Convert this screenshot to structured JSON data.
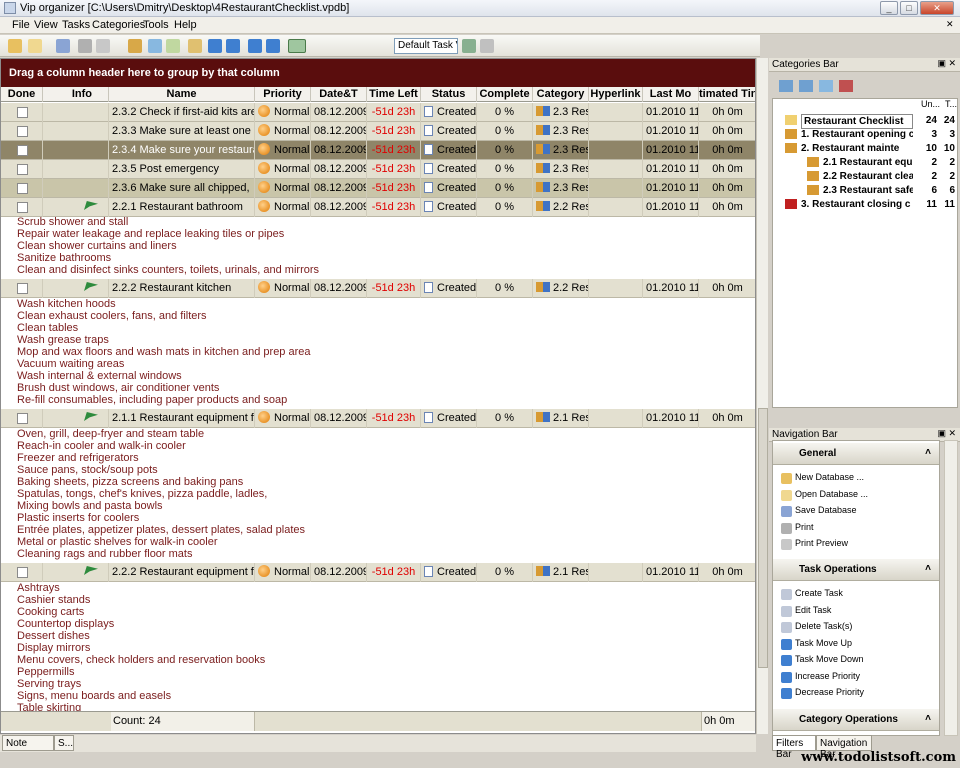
{
  "window": {
    "title": "Vip organizer [C:\\Users\\Dmitry\\Desktop\\4RestaurantChecklist.vpdb]"
  },
  "menu": [
    "File",
    "View",
    "Tasks",
    "Categories",
    "Tools",
    "Help"
  ],
  "toolbar": {
    "task_view": "Default Task V"
  },
  "grid": {
    "group_hint": "Drag a column header here to group by that column",
    "columns": [
      "Done",
      "Info",
      "Name",
      "Priority",
      "Date&T",
      "Time Left",
      "Status",
      "Complete",
      "Category",
      "Hyperlink",
      "Last Mo",
      "timated Tin"
    ],
    "rows": [
      {
        "name": "2.3.2 Check if first-aid kits are",
        "priority": "Normal",
        "date": "08.12.2009",
        "left": "-51d 23h",
        "status": "Created",
        "complete": "0 %",
        "category": "2.3 Rest",
        "lastmod": "01.2010 11:",
        "est": "0h 0m"
      },
      {
        "name": "2.3.3 Make sure at least one",
        "priority": "Normal",
        "date": "08.12.2009",
        "left": "-51d 23h",
        "status": "Created",
        "complete": "0 %",
        "category": "2.3 Rest",
        "lastmod": "01.2010 11:",
        "est": "0h 0m"
      },
      {
        "name": "2.3.4 Make sure your restaurant",
        "priority": "Normal",
        "date": "08.12.2009",
        "left": "-51d 23h",
        "status": "Created",
        "complete": "0 %",
        "category": "2.3 Rest",
        "lastmod": "01.2010 11:",
        "est": "0h 0m"
      },
      {
        "name": "2.3.5 Post emergency",
        "priority": "Normal",
        "date": "08.12.2009",
        "left": "-51d 23h",
        "status": "Created",
        "complete": "0 %",
        "category": "2.3 Rest",
        "lastmod": "01.2010 11:",
        "est": "0h 0m"
      },
      {
        "name": "2.3.6 Make sure all chipped,",
        "priority": "Normal",
        "date": "08.12.2009",
        "left": "-51d 23h",
        "status": "Created",
        "complete": "0 %",
        "category": "2.3 Rest",
        "lastmod": "01.2010 11:",
        "est": "0h 0m"
      },
      {
        "name": "2.2.1 Restaurant bathroom",
        "priority": "Normal",
        "date": "08.12.2009",
        "left": "-51d 23h",
        "status": "Created",
        "complete": "0 %",
        "category": "2.2 Rest",
        "lastmod": "01.2010 11:",
        "est": "0h 0m"
      },
      {
        "name": "2.2.2 Restaurant kitchen",
        "priority": "Normal",
        "date": "08.12.2009",
        "left": "-51d 23h",
        "status": "Created",
        "complete": "0 %",
        "category": "2.2 Rest",
        "lastmod": "01.2010 11:",
        "est": "0h 0m"
      },
      {
        "name": "2.1.1 Restaurant equipment for",
        "priority": "Normal",
        "date": "08.12.2009",
        "left": "-51d 23h",
        "status": "Created",
        "complete": "0 %",
        "category": "2.1 Rest",
        "lastmod": "01.2010 11:",
        "est": "0h 0m"
      },
      {
        "name": "2.2.2 Restaurant equipment for",
        "priority": "Normal",
        "date": "08.12.2009",
        "left": "-51d 23h",
        "status": "Created",
        "complete": "0 %",
        "category": "2.1 Rest",
        "lastmod": "01.2010 11:",
        "est": "0h 0m"
      }
    ],
    "notes": [
      [
        "Scrub shower and stall",
        "Repair water leakage and replace leaking tiles or pipes",
        "Clean shower curtains and liners",
        "Sanitize bathrooms",
        "Clean and disinfect sinks counters, toilets, urinals, and mirrors"
      ],
      [
        "Wash kitchen hoods",
        "Clean exhaust coolers, fans, and filters",
        "Clean tables",
        "Wash grease traps",
        "Mop and wax floors and wash mats in kitchen and prep area",
        "Vacuum waiting areas",
        "Wash internal & external windows",
        "Brush dust windows, air conditioner vents",
        "Re-fill consumables, including paper products and soap"
      ],
      [
        "Oven, grill, deep-fryer and steam table",
        "Reach-in cooler and walk-in cooler",
        "Freezer and refrigerators",
        "Sauce pans, stock/soup pots",
        "Baking sheets, pizza screens and baking pans",
        "Spatulas, tongs, chef's knives, pizza paddle, ladles,",
        "Mixing bowls and pasta bowls",
        "Plastic inserts for coolers",
        "Entrée plates, appetizer plates, dessert plates, salad plates",
        "Metal or plastic shelves for walk-in cooler",
        "Cleaning rags and rubber floor mats"
      ],
      [
        "Ashtrays",
        "Cashier stands",
        "Cooking carts",
        "Countertop displays",
        "Dessert dishes",
        "Display mirrors",
        "Menu covers, check holders and reservation books",
        "Peppermills",
        "Serving trays",
        "Signs, menu boards and easels",
        "Table skirting"
      ]
    ],
    "footer": {
      "count": "Count: 24",
      "est": "0h 0m"
    }
  },
  "note_tabs": [
    "Note",
    "S..."
  ],
  "categories": {
    "title": "Categories Bar",
    "col_un": "Un...",
    "col_t": "T...",
    "items": [
      {
        "label": "Restaurant Checklist",
        "a": "24",
        "b": "24"
      },
      {
        "label": "1. Restaurant opening c",
        "a": "3",
        "b": "3"
      },
      {
        "label": "2. Restaurant mainte",
        "a": "10",
        "b": "10"
      },
      {
        "label": "2.1 Restaurant equip",
        "a": "2",
        "b": "2"
      },
      {
        "label": "2.2 Restaurant clean",
        "a": "2",
        "b": "2"
      },
      {
        "label": "2.3 Restaurant safet",
        "a": "6",
        "b": "6"
      },
      {
        "label": "3. Restaurant closing c",
        "a": "11",
        "b": "11"
      }
    ]
  },
  "navigation": {
    "title": "Navigation Bar",
    "general": {
      "title": "General",
      "items": [
        "New Database ...",
        "Open Database ...",
        "Save Database",
        "Print",
        "Print Preview"
      ]
    },
    "tasks": {
      "title": "Task Operations",
      "items": [
        "Create Task",
        "Edit Task",
        "Delete Task(s)",
        "Task Move Up",
        "Task Move Down",
        "Increase Priority",
        "Decrease Priority"
      ]
    },
    "cats": {
      "title": "Category Operations"
    }
  },
  "bottom_tabs": [
    "Filters Bar",
    "Navigation Bar"
  ],
  "watermark": "www.todolistsoft.com"
}
